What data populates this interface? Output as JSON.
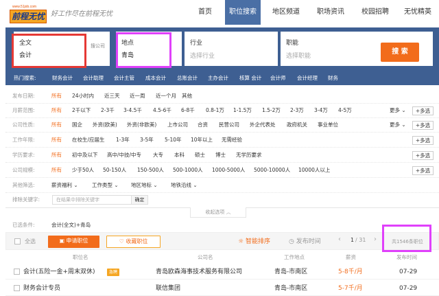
{
  "header": {
    "logo_url": "www.51job.com",
    "logo_text": "前程无忧",
    "slogan": "好工作尽在前程无忧",
    "nav": [
      "首页",
      "职位搜索",
      "地区频道",
      "职场资讯",
      "校园招聘",
      "无忧精英"
    ],
    "active_nav": 1
  },
  "search": {
    "fulltext_label": "全文",
    "fulltext_value": "会计",
    "company_toggle": "搜公司",
    "location_label": "地点",
    "location_value": "青岛",
    "industry_label": "行业",
    "industry_placeholder": "选择行业",
    "function_label": "职能",
    "function_placeholder": "选择职能",
    "search_button": "搜 索"
  },
  "hot": {
    "label": "热门搜索:",
    "items": [
      "财务会计",
      "会计助理",
      "会计主管",
      "成本会计",
      "总账会计",
      "主办会计",
      "核算 会计",
      "会计师",
      "会计经理",
      "财务"
    ]
  },
  "filters": [
    {
      "label": "发布日期:",
      "options": [
        "所有",
        "24小时内",
        "近三天",
        "近一周",
        "近一个月",
        "其他"
      ]
    },
    {
      "label": "月薪范围:",
      "options": [
        "所有",
        "2千以下",
        "2-3千",
        "3-4.5千",
        "4.5-6千",
        "6-8千",
        "0.8-1万",
        "1-1.5万",
        "1.5-2万",
        "2-3万",
        "3-4万",
        "4-5万"
      ],
      "more": "更多",
      "multi": "+多选"
    },
    {
      "label": "公司性质:",
      "options": [
        "所有",
        "国企",
        "外资(欧美)",
        "外资(非欧美)",
        "上市公司",
        "合资",
        "民营公司",
        "外企代表处",
        "政府机关",
        "事业单位"
      ],
      "more": "更多",
      "multi": "+多选"
    },
    {
      "label": "工作年限:",
      "options": [
        "所有",
        "在校生/应届生",
        "1-3年",
        "3-5年",
        "5-10年",
        "10年以上",
        "无需经验"
      ],
      "multi": "+多选"
    },
    {
      "label": "学历要求:",
      "options": [
        "所有",
        "初中及以下",
        "高中/中技/中专",
        "大专",
        "本科",
        "硕士",
        "博士",
        "无学历要求"
      ],
      "multi": "+多选"
    },
    {
      "label": "公司规模:",
      "options": [
        "所有",
        "少于50人",
        "50-150人",
        "150-500人",
        "500-1000人",
        "1000-5000人",
        "5000-10000人",
        "10000人以上"
      ],
      "multi": "+多选"
    }
  ],
  "other_conditions": {
    "label": "其他筛选:",
    "dropdowns": [
      "薪资福利",
      "工作类型",
      "地区地标",
      "地铁沿线"
    ]
  },
  "exclude": {
    "label": "排除关键字:",
    "placeholder": "在结果中排除关键字",
    "button": "确定"
  },
  "collapse_label": "收起选项 ︿",
  "selected": {
    "label": "已选条件:",
    "value": "会计(全文)+青岛"
  },
  "toolbar": {
    "select_all": "全选",
    "apply": "申请职位",
    "favorite": "收藏职位",
    "smart_sort": "智能排序",
    "date_sort": "发布时间",
    "page": "1",
    "pages": "/ 31",
    "total": "共1546条职位"
  },
  "table": {
    "headers": [
      "职位名",
      "公司名",
      "工作地点",
      "薪资",
      "发布时间"
    ],
    "rows": [
      {
        "title": "会计(五险一金+周末双休)",
        "badge": "急聘",
        "company": "青岛欧森海事技术服务有限公司",
        "location": "青岛-市南区",
        "salary": "5-8千/月",
        "date": "07-29"
      },
      {
        "title": "财务会计专员",
        "badge": "",
        "company": "联信集团",
        "location": "青岛-市南区",
        "salary": "5-7千/月",
        "date": "07-29"
      }
    ]
  },
  "colors": {
    "accent": "#f26c1b",
    "panel": "#3e5f92",
    "highlight_red": "#e53935",
    "highlight_magenta": "#e040fb"
  }
}
